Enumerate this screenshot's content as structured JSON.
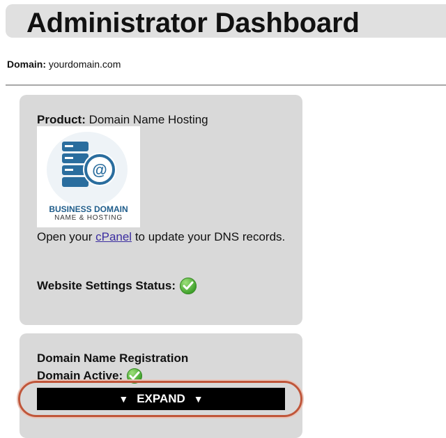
{
  "header": {
    "title": "Administrator Dashboard"
  },
  "domain": {
    "label": "Domain:",
    "value": "yourdomain.com"
  },
  "product_card": {
    "label": "Product:",
    "value": "Domain Name Hosting",
    "logo": {
      "line1": "BUSINESS DOMAIN",
      "line2": "NAME & HOSTING",
      "icon": "server-at-icon"
    },
    "cpanel_before": "Open your ",
    "cpanel_link": "cPanel",
    "cpanel_after": " to update your DNS records.",
    "status_label": "Website Settings Status:",
    "status_icon": "green-check-icon"
  },
  "registration_card": {
    "title": "Domain Name Registration",
    "active_label": "Domain Active:",
    "active_icon": "green-check-icon",
    "expand_label": "EXPAND",
    "expand_arrow": "▼"
  },
  "colors": {
    "card_bg": "#d9d9d9",
    "header_bg": "#e0e0e0",
    "link": "#3b2da0",
    "highlight": "#c0563a",
    "check_green": "#3ea02a",
    "logo_blue": "#2a6d9e"
  }
}
